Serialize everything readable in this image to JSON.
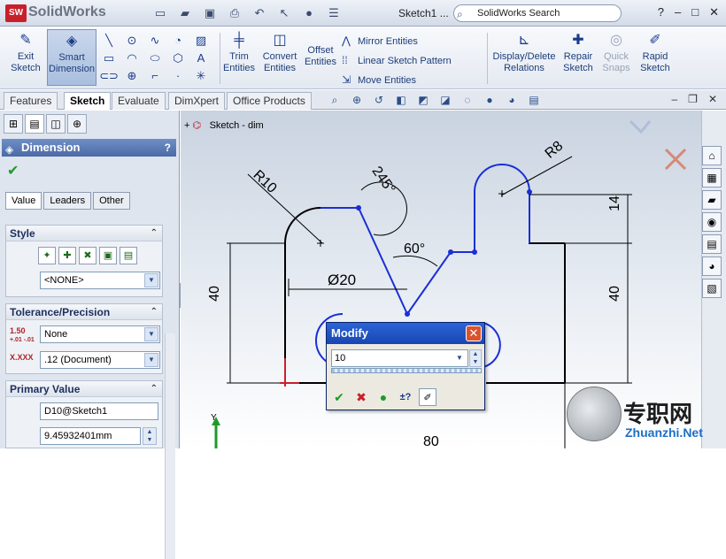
{
  "titlebar": {
    "brand": "SolidWorks",
    "doc_title": "Sketch1 ...",
    "search_placeholder": "SolidWorks Search",
    "help": "?",
    "window_buttons": [
      "–",
      "□",
      "✕"
    ]
  },
  "cmd": {
    "exit_sketch": [
      "Exit",
      "Sketch"
    ],
    "smart_dimension": [
      "Smart",
      "Dimension"
    ],
    "trim": [
      "Trim",
      "Entities"
    ],
    "convert": [
      "Convert",
      "Entities"
    ],
    "offset": [
      "Offset",
      "Entities"
    ],
    "mirror": "Mirror Entities",
    "linear_pattern": "Linear Sketch Pattern",
    "move": "Move Entities",
    "display_delete": [
      "Display/Delete",
      "Relations"
    ],
    "repair": [
      "Repair",
      "Sketch"
    ],
    "quick_snaps": [
      "Quick",
      "Snaps"
    ],
    "rapid": [
      "Rapid",
      "Sketch"
    ]
  },
  "tabs": [
    "Features",
    "Sketch",
    "Evaluate",
    "DimXpert",
    "Office Products"
  ],
  "tree_item": "Sketch - dim",
  "pm": {
    "title": "Dimension",
    "help": "?",
    "subtabs": [
      "Value",
      "Leaders",
      "Other"
    ],
    "style": {
      "title": "Style",
      "value": "<NONE>"
    },
    "tolerance": {
      "title": "Tolerance/Precision",
      "type": "None",
      "precision": ".12 (Document)",
      "icon_value": "1.50",
      "icon_tol": "+.01 -.01",
      "icon_prec": "X.XXX"
    },
    "primary": {
      "title": "Primary Value",
      "name": "D10@Sketch1",
      "value": "9.45932401mm"
    }
  },
  "dims": {
    "r10": "R10",
    "a245": "245°",
    "r8": "R8",
    "a60": "60°",
    "d20": "Ø20",
    "l14": "14",
    "l40a": "40",
    "l40b": "40",
    "l80": "80"
  },
  "modify": {
    "title": "Modify",
    "value": "10"
  },
  "axis_y": "Y",
  "watermark": {
    "cn": "专职网",
    "url": "Zhuanzhi.Net"
  },
  "colors": {
    "sketch_blue": "#1a2fd6",
    "sketch_black": "#000000",
    "title_blue": "#1746b3"
  }
}
